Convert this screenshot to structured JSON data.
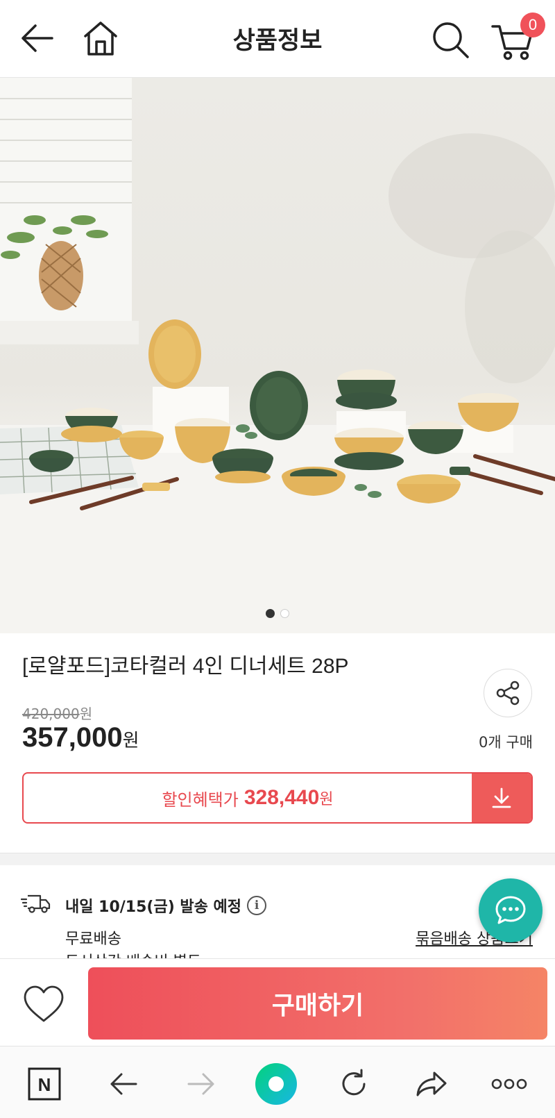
{
  "header": {
    "title": "상품정보",
    "cart_count": "0",
    "icons": [
      "back-arrow-icon",
      "home-icon",
      "search-icon",
      "cart-icon"
    ]
  },
  "carousel": {
    "total": 2,
    "active": 0
  },
  "product": {
    "name": "[로얄포드]코타컬러 4인 디너세트 28P",
    "original_price": "420,000",
    "original_price_unit": "원",
    "price": "357,000",
    "price_unit": "원",
    "purchase_count": "0개 구매"
  },
  "coupon": {
    "label": "할인혜택가",
    "price": "328,440",
    "unit": "원"
  },
  "shipping": {
    "date": "내일 10/15(금) 발송 예정",
    "info_glyph": "i",
    "free": "무료배송",
    "extra": "도서산간 배송비 별도",
    "bundle_link": "묶음배송 상품보기"
  },
  "buy_bar": {
    "buy_label": "구매하기"
  },
  "browser_nav": {
    "logo_letter": "N"
  },
  "colors": {
    "accent": "#ee4f5a",
    "chat": "#1fb6a8",
    "mustard": "#e4b85e",
    "green": "#3e5940"
  }
}
